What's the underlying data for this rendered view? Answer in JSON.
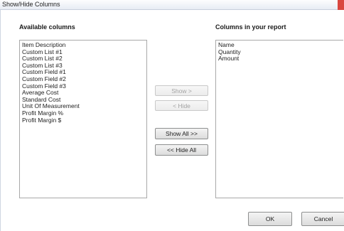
{
  "window": {
    "title": "Show/Hide Columns"
  },
  "available": {
    "heading": "Available columns",
    "items": [
      "Item Description",
      "Custom List #1",
      "Custom List #2",
      "Custom List #3",
      "Custom Field #1",
      "Custom Field #2",
      "Custom Field #3",
      "Average Cost",
      "Standard Cost",
      "Unit Of Measurement",
      "Profit Margin %",
      "Profit Margin $"
    ]
  },
  "report": {
    "heading": "Columns in your report",
    "items": [
      "Name",
      "Quantity",
      "Amount"
    ]
  },
  "buttons": {
    "show": "Show >",
    "hide": "< Hide",
    "show_all": "Show All >>",
    "hide_all": "<< Hide All",
    "ok": "OK",
    "cancel": "Cancel"
  }
}
